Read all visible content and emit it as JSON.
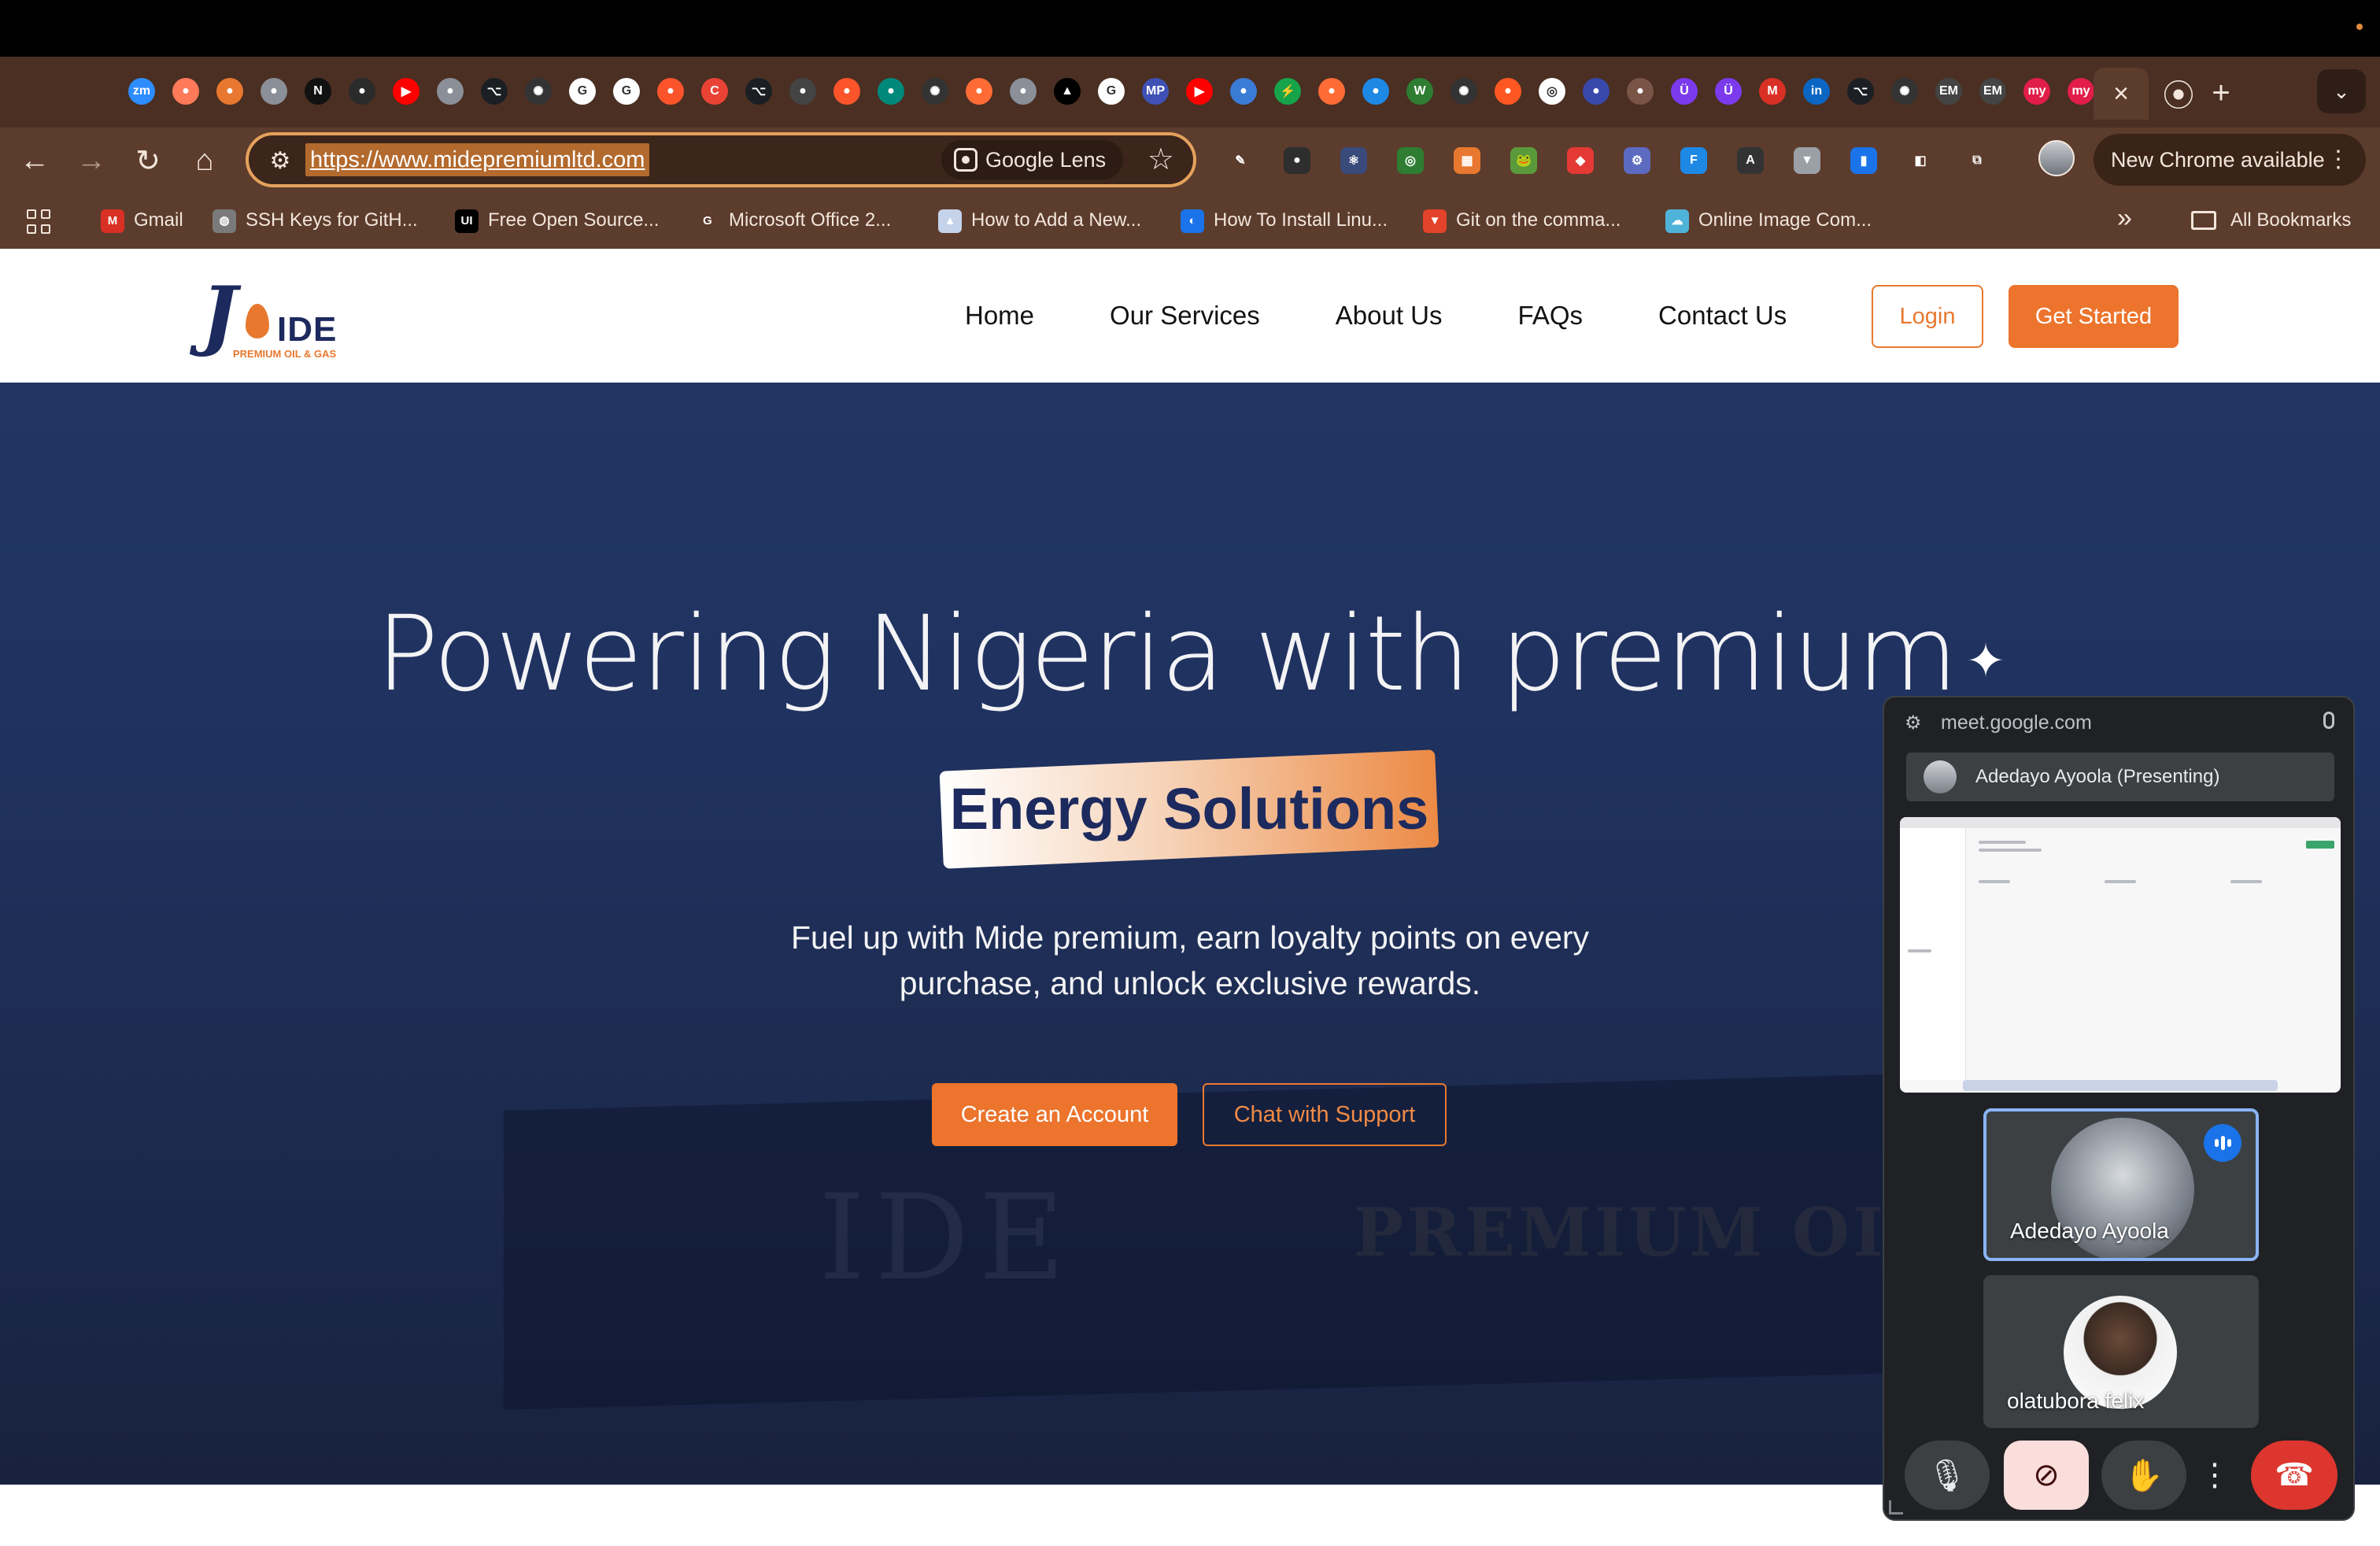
{
  "browser": {
    "tabs": {
      "favicon_names": [
        "zoom",
        "clock-orange",
        "arrow-orange",
        "globe",
        "nextjs",
        "chart",
        "youtube",
        "globe",
        "github",
        "openai",
        "google",
        "google",
        "brave",
        "google-red",
        "github",
        "bug",
        "brave",
        "meet",
        "openai",
        "target",
        "globe",
        "vercel",
        "google",
        "mp",
        "youtube",
        "earth",
        "bolt",
        "target",
        "blob",
        "w",
        "openai",
        "m-colorful",
        "chrome",
        "network",
        "brand",
        "u-purple",
        "u-purple",
        "gmail",
        "linkedin",
        "github",
        "openai",
        "emx",
        "emx",
        "my",
        "my"
      ],
      "active_tab_close": "×",
      "after_active_icon": "record-icon",
      "new_tab": "+",
      "tab_menu": "⌄"
    },
    "toolbar": {
      "url": "https://www.midepremiumltd.com",
      "lens_label": "Google Lens",
      "new_chrome_label": "New Chrome available",
      "extension_names": [
        "eyedropper",
        "recorder",
        "react-devtools",
        "target",
        "metamask",
        "frog",
        "redux",
        "gear",
        "tailwind",
        "brave",
        "vue",
        "docs",
        "mirror",
        "puzzle"
      ]
    },
    "bookmarks": [
      {
        "label": "Gmail",
        "icon": "gmail-icon",
        "color": "#d93025",
        "glyph": "M"
      },
      {
        "label": "SSH Keys for GitH...",
        "icon": "globe-icon",
        "color": "#7a7a7a",
        "glyph": "◍"
      },
      {
        "label": "Free Open Source...",
        "icon": "ui-icon",
        "color": "#000000",
        "glyph": "UI"
      },
      {
        "label": "Microsoft Office 2...",
        "icon": "g-icon",
        "color": "#5c3c2c",
        "glyph": "G"
      },
      {
        "label": "How to Add a New...",
        "icon": "doc-icon",
        "color": "#c5d3ea",
        "glyph": "▲"
      },
      {
        "label": "How To Install Linu...",
        "icon": "digitalocean-icon",
        "color": "#1a73e8",
        "glyph": "◐"
      },
      {
        "label": "Git on the comma...",
        "icon": "gitlab-icon",
        "color": "#e2432a",
        "glyph": "▼"
      },
      {
        "label": "Online Image Com...",
        "icon": "cloud-icon",
        "color": "#4fb3d9",
        "glyph": "☁"
      }
    ],
    "bookmarks_more": "»",
    "all_bookmarks": "All Bookmarks"
  },
  "site": {
    "logo_text": "IDE",
    "logo_sub": "PREMIUM OIL & GAS",
    "nav": [
      "Home",
      "Our Services",
      "About Us",
      "FAQs",
      "Contact Us"
    ],
    "login": "Login",
    "get_started": "Get Started",
    "hero": {
      "title": "Powering Nigeria with premium",
      "badge": "Energy Solutions",
      "description_line1": "Fuel up with Mide premium, earn loyalty points on every",
      "description_line2": "purchase, and unlock exclusive rewards.",
      "cta_primary": "Create an Account",
      "cta_secondary": "Chat with Support"
    },
    "colors": {
      "brand_navy": "#1d2a5e",
      "brand_orange": "#ec742c"
    }
  },
  "meet": {
    "url": "meet.google.com",
    "presenting_label": "Adedayo Ayoola (Presenting)",
    "participants": [
      {
        "name": "Adedayo Ayoola",
        "speaking": true
      },
      {
        "name": "olatubora felix",
        "speaking": false
      }
    ]
  }
}
